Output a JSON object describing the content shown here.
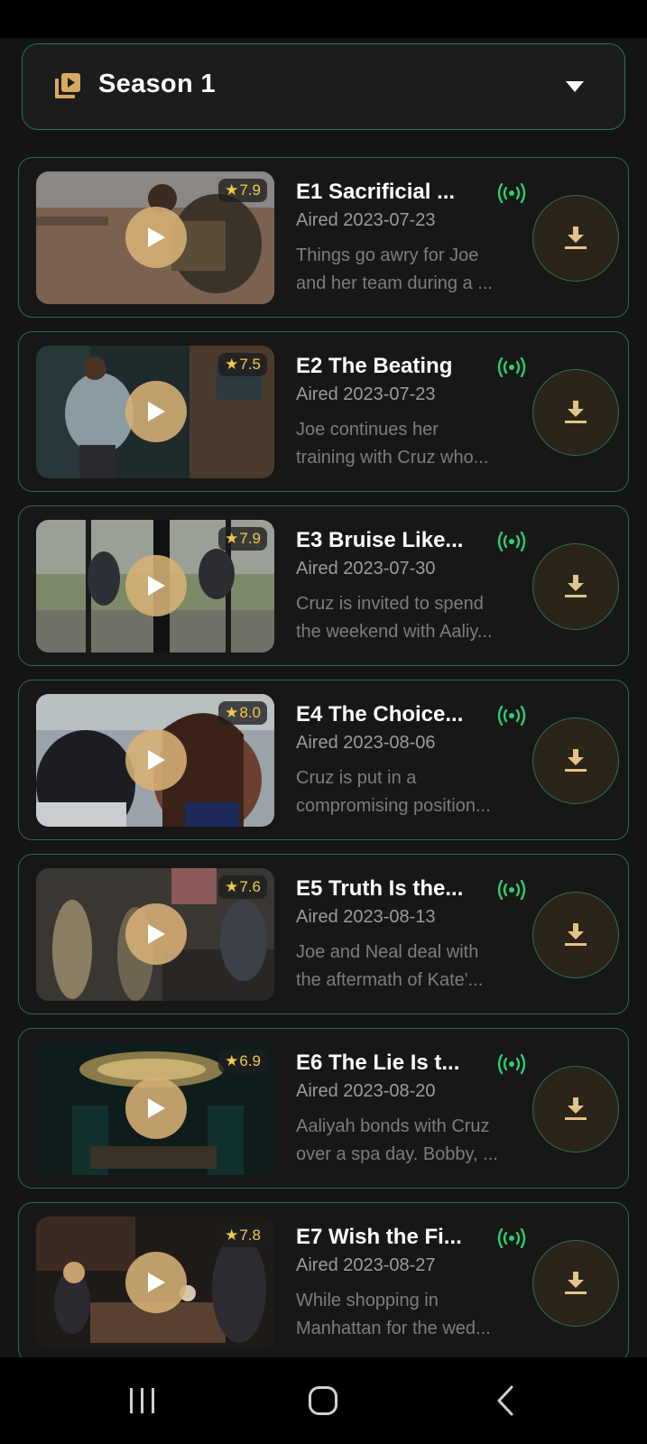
{
  "season_selector": {
    "label": "Season 1",
    "icon": "play-library-icon",
    "dropdown_icon": "chevron-down-icon"
  },
  "colors": {
    "accent_border": "#2f6e59",
    "rating": "#f2c94c",
    "play_button": "#d7b076",
    "signal": "#2ecc71",
    "download_icon": "#e0c48a"
  },
  "episodes": [
    {
      "title": "E1  Sacrificial ...",
      "rating": "7.9",
      "aired": "Aired 2023-07-23",
      "desc_line1": "Things go awry for Joe",
      "desc_line2": "and her team during a ..."
    },
    {
      "title": "E2  The Beating",
      "rating": "7.5",
      "aired": "Aired 2023-07-23",
      "desc_line1": "Joe continues her",
      "desc_line2": "training with Cruz who..."
    },
    {
      "title": "E3  Bruise Like...",
      "rating": "7.9",
      "aired": "Aired 2023-07-30",
      "desc_line1": "Cruz is invited to spend",
      "desc_line2": "the weekend with Aaliy..."
    },
    {
      "title": "E4  The Choice...",
      "rating": "8.0",
      "aired": "Aired 2023-08-06",
      "desc_line1": "Cruz is put in a",
      "desc_line2": "compromising position..."
    },
    {
      "title": "E5  Truth Is the...",
      "rating": "7.6",
      "aired": "Aired 2023-08-13",
      "desc_line1": "Joe and Neal deal with",
      "desc_line2": "the aftermath of Kate'..."
    },
    {
      "title": "E6  The Lie Is t...",
      "rating": "6.9",
      "aired": "Aired 2023-08-20",
      "desc_line1": "Aaliyah bonds with Cruz",
      "desc_line2": "over a spa day. Bobby, ..."
    },
    {
      "title": "E7  Wish the Fi...",
      "rating": "7.8",
      "aired": "Aired 2023-08-27",
      "desc_line1": "While shopping in",
      "desc_line2": "Manhattan for the wed..."
    }
  ],
  "nav": {
    "recents": "recents-icon",
    "home": "home-icon",
    "back": "back-icon"
  }
}
